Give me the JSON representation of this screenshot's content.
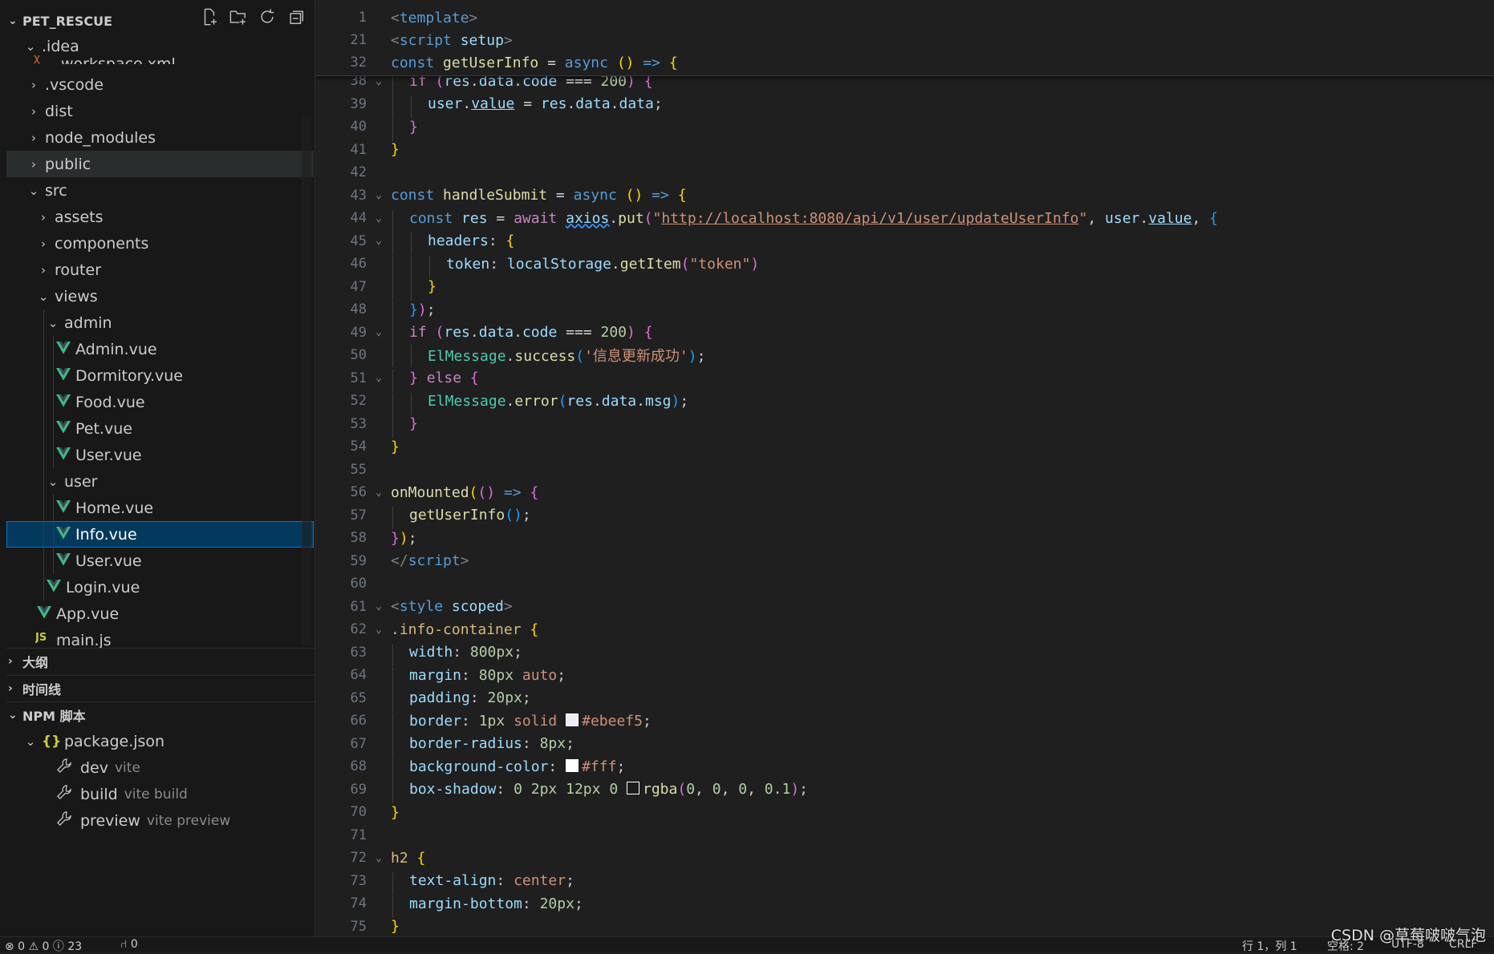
{
  "explorer": {
    "root": "PET_RESCUE",
    "items": [
      {
        "label": ".idea",
        "kind": "folder-open"
      },
      {
        "label": "workspace.xml",
        "kind": "xml"
      },
      {
        "label": ".vscode",
        "kind": "folder"
      },
      {
        "label": "dist",
        "kind": "folder"
      },
      {
        "label": "node_modules",
        "kind": "folder"
      },
      {
        "label": "public",
        "kind": "folder"
      },
      {
        "label": "src",
        "kind": "folder-open"
      },
      {
        "label": "assets",
        "kind": "folder"
      },
      {
        "label": "components",
        "kind": "folder"
      },
      {
        "label": "router",
        "kind": "folder"
      },
      {
        "label": "views",
        "kind": "folder-open"
      },
      {
        "label": "admin",
        "kind": "folder-open"
      },
      {
        "label": "Admin.vue",
        "kind": "vue"
      },
      {
        "label": "Dormitory.vue",
        "kind": "vue"
      },
      {
        "label": "Food.vue",
        "kind": "vue"
      },
      {
        "label": "Pet.vue",
        "kind": "vue"
      },
      {
        "label": "User.vue",
        "kind": "vue"
      },
      {
        "label": "user",
        "kind": "folder-open"
      },
      {
        "label": "Home.vue",
        "kind": "vue"
      },
      {
        "label": "Info.vue",
        "kind": "vue"
      },
      {
        "label": "User.vue",
        "kind": "vue"
      },
      {
        "label": "Login.vue",
        "kind": "vue"
      },
      {
        "label": "App.vue",
        "kind": "vue"
      },
      {
        "label": "main.js",
        "kind": "js"
      }
    ]
  },
  "sections": {
    "outline": "大纲",
    "timeline": "时间线",
    "npm": "NPM 脚本"
  },
  "npm": {
    "package": "package.json",
    "scripts": [
      {
        "name": "dev",
        "cmd": "vite"
      },
      {
        "name": "build",
        "cmd": "vite build"
      },
      {
        "name": "preview",
        "cmd": "vite preview"
      }
    ]
  },
  "editor": {
    "sticky_lines": [
      {
        "num": "1",
        "text": "<template>"
      },
      {
        "num": "21",
        "text": "<script setup>"
      },
      {
        "num": "32",
        "text": "const getUserInfo = async () => {"
      }
    ],
    "url": "http://localhost:8080/api/v1/user/updateUserInfo",
    "success_msg": "'信息更新成功'",
    "line_numbers": [
      "38",
      "39",
      "40",
      "41",
      "42",
      "43",
      "44",
      "45",
      "46",
      "47",
      "48",
      "49",
      "50",
      "51",
      "52",
      "53",
      "54",
      "55",
      "56",
      "57",
      "58",
      "59",
      "60",
      "61",
      "62",
      "63",
      "64",
      "65",
      "66",
      "67",
      "68",
      "69",
      "70",
      "71",
      "72",
      "73",
      "74",
      "75"
    ],
    "colors": {
      "border": "#ebeef5",
      "bg": "#fff"
    }
  },
  "status": {
    "problems": "⊗ 0 ⚠ 0 ⓘ 23",
    "ports": "⑁ 0",
    "position": "行 1，列 1",
    "spaces": "空格: 2",
    "encoding": "UTF-8",
    "eol": "CRLF"
  },
  "watermark": "CSDN @草莓啵啵气泡"
}
